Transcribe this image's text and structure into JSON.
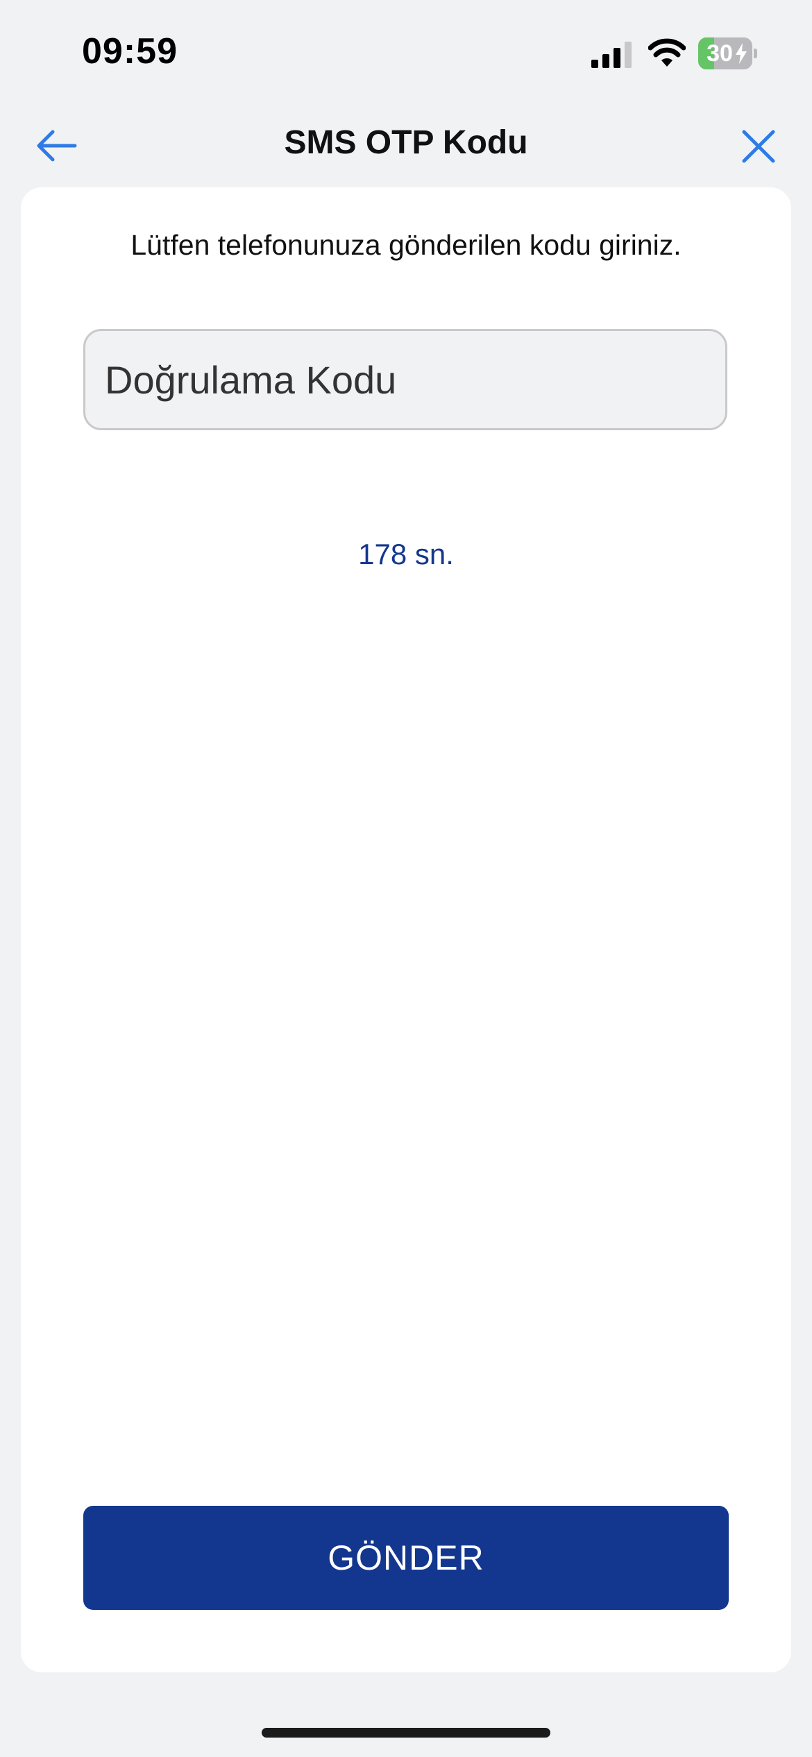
{
  "status_bar": {
    "time": "09:59",
    "battery_percent": "30",
    "battery_level": 0.3,
    "battery_charging": true,
    "icons": [
      "signal-icon",
      "wifi-icon",
      "battery-icon"
    ]
  },
  "nav": {
    "title": "SMS OTP Kodu",
    "back_icon": "arrow-left-icon",
    "close_icon": "close-icon"
  },
  "content": {
    "instruction": "Lütfen telefonunuza gönderilen kodu giriniz.",
    "code_input": {
      "placeholder": "Doğrulama Kodu",
      "value": ""
    },
    "countdown": "178 sn.",
    "submit_label": "GÖNDER"
  },
  "colors": {
    "accent_blue": "#2f7be5",
    "primary_button": "#13378e",
    "countdown_text": "#14378f",
    "background": "#f1f2f4",
    "battery_green": "#65c466"
  }
}
